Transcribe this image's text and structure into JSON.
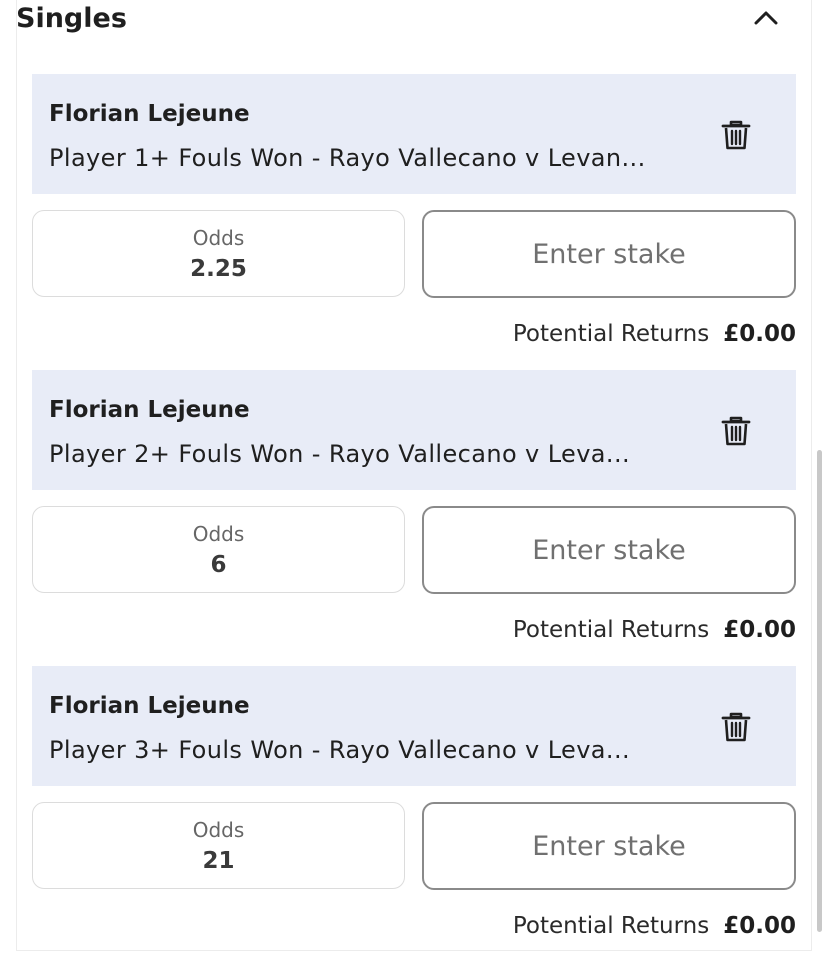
{
  "section": {
    "title": "Singles"
  },
  "bets": [
    {
      "selection": "Florian Lejeune",
      "market": "Player 1+ Fouls Won - Rayo Vallecano v Levan...",
      "odds_label": "Odds",
      "odds": "2.25",
      "stake_placeholder": "Enter stake",
      "returns_label": "Potential Returns",
      "returns_value": "£0.00"
    },
    {
      "selection": "Florian Lejeune",
      "market": "Player 2+ Fouls Won - Rayo Vallecano v Leva...",
      "odds_label": "Odds",
      "odds": "6",
      "stake_placeholder": "Enter stake",
      "returns_label": "Potential Returns",
      "returns_value": "£0.00"
    },
    {
      "selection": "Florian Lejeune",
      "market": "Player 3+ Fouls Won - Rayo Vallecano v Leva...",
      "odds_label": "Odds",
      "odds": "21",
      "stake_placeholder": "Enter stake",
      "returns_label": "Potential Returns",
      "returns_value": "£0.00"
    }
  ],
  "icons": {
    "collapse": "chevron-up-icon",
    "delete": "trash-icon"
  }
}
